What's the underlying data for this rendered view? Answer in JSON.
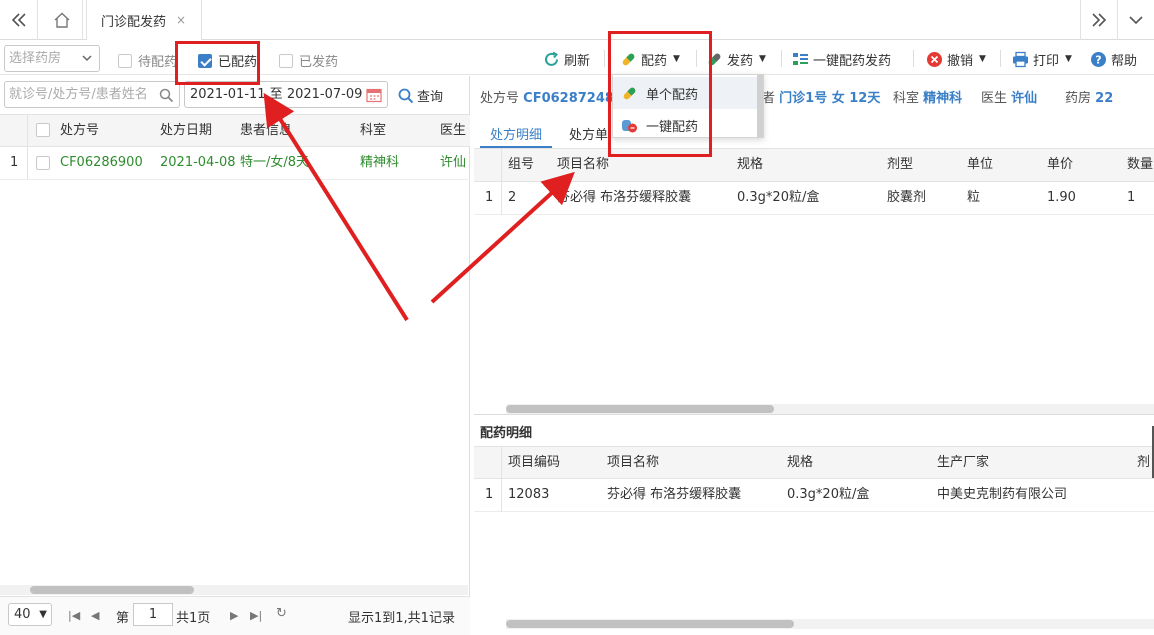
{
  "tabbar": {
    "back_icon": "double-chevron-left-icon",
    "home_icon": "home-icon",
    "active_tab": "门诊配发药",
    "close_glyph": "×",
    "next_icon": "double-chevron-right-icon",
    "menu_icon": "chevron-down-icon"
  },
  "toolbar": {
    "pharmacy_placeholder": "选择药房",
    "filters": [
      {
        "label": "待配药",
        "checked": false
      },
      {
        "label": "已配药",
        "checked": true
      },
      {
        "label": "已发药",
        "checked": false
      }
    ],
    "buttons": {
      "refresh": "刷新",
      "dispense_prepare": "配药",
      "dispense": "发药",
      "one_key": "一键配药发药",
      "revoke": "撤销",
      "print": "打印",
      "help": "帮助"
    }
  },
  "dropdown": {
    "items": [
      "单个配药",
      "一键配药"
    ]
  },
  "search": {
    "placeholder": "就诊号/处方号/患者姓名",
    "date_range": "2021-01-11 至 2021-07-09",
    "query_label": "查询"
  },
  "left_grid": {
    "columns": [
      "处方号",
      "处方日期",
      "患者信息",
      "科室",
      "医生"
    ],
    "rows": [
      {
        "num": "1",
        "rx": "CF06286900",
        "date": "2021-04-08",
        "patient": "特一/女/8天",
        "dept": "精神科",
        "doctor": "许仙"
      }
    ]
  },
  "pager": {
    "page_size": "40",
    "page_prefix": "第",
    "page_no": "1",
    "page_total": "共1页",
    "summary": "显示1到1,共1记录"
  },
  "rx_info": {
    "rx_label": "处方号",
    "rx_value": "CF06287248",
    "patient_tail_label": "者",
    "patient_value": "门诊1号 女 12天",
    "dept_label": "科室",
    "dept_value": "精神科",
    "doctor_label": "医生",
    "doctor_value": "许仙",
    "pharmacy_label": "药房",
    "pharmacy_value": "22"
  },
  "sub_tabs": [
    "处方明细",
    "处方单"
  ],
  "rx_detail": {
    "columns": [
      "组号",
      "项目名称",
      "规格",
      "剂型",
      "单位",
      "单价",
      "数量"
    ],
    "rows": [
      {
        "num": "1",
        "group": "2",
        "name": "芬必得 布洛芬缓释胶囊",
        "spec": "0.3g*20粒/盒",
        "form": "胶囊剂",
        "unit": "粒",
        "price": "1.90",
        "qty": "1"
      }
    ]
  },
  "dispense_detail": {
    "title": "配药明细",
    "columns": [
      "项目编码",
      "项目名称",
      "规格",
      "生产厂家",
      "剂"
    ],
    "rows": [
      {
        "num": "1",
        "code": "12083",
        "name": "芬必得 布洛芬缓释胶囊",
        "spec": "0.3g*20粒/盒",
        "maker": "中美史克制药有限公司"
      }
    ]
  },
  "colors": {
    "accent": "#3a7fc8",
    "green_text": "#2d8c2d",
    "annotation_red": "#e02020"
  }
}
